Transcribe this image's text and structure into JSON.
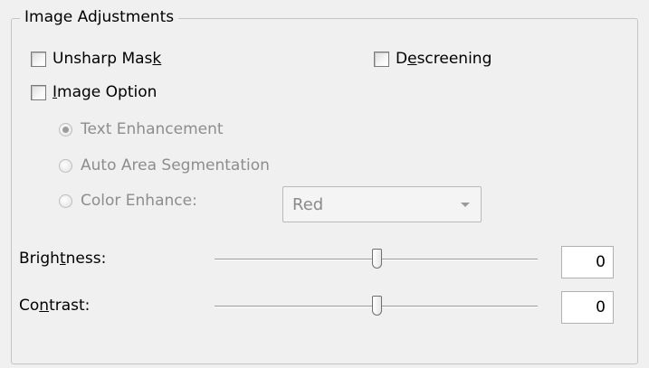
{
  "group": {
    "title": "Image Adjustments"
  },
  "checkboxes": {
    "unsharp_mask": {
      "label_pre": "Unsharp Mas",
      "label_ul": "k",
      "label_post": "",
      "checked": false
    },
    "descreening": {
      "label_pre": "D",
      "label_ul": "e",
      "label_post": "screening",
      "checked": false
    },
    "image_option": {
      "label_pre": "",
      "label_ul": "I",
      "label_post": "mage Option",
      "checked": false
    }
  },
  "radios": {
    "text_enhancement": {
      "label": "Text Enhancement",
      "checked": true,
      "enabled": false
    },
    "auto_area_segmentation": {
      "label": "Auto Area Segmentation",
      "checked": false,
      "enabled": false
    },
    "color_enhance": {
      "label": "Color Enhance:",
      "checked": false,
      "enabled": false
    }
  },
  "color_select": {
    "value": "Red"
  },
  "brightness": {
    "label_pre": "Brigh",
    "label_ul": "t",
    "label_post": "ness:",
    "value": "0",
    "range": [
      -100,
      100
    ],
    "slider_value": 0
  },
  "contrast": {
    "label_pre": "Co",
    "label_ul": "n",
    "label_post": "trast:",
    "value": "0",
    "range": [
      -100,
      100
    ],
    "slider_value": 0
  }
}
